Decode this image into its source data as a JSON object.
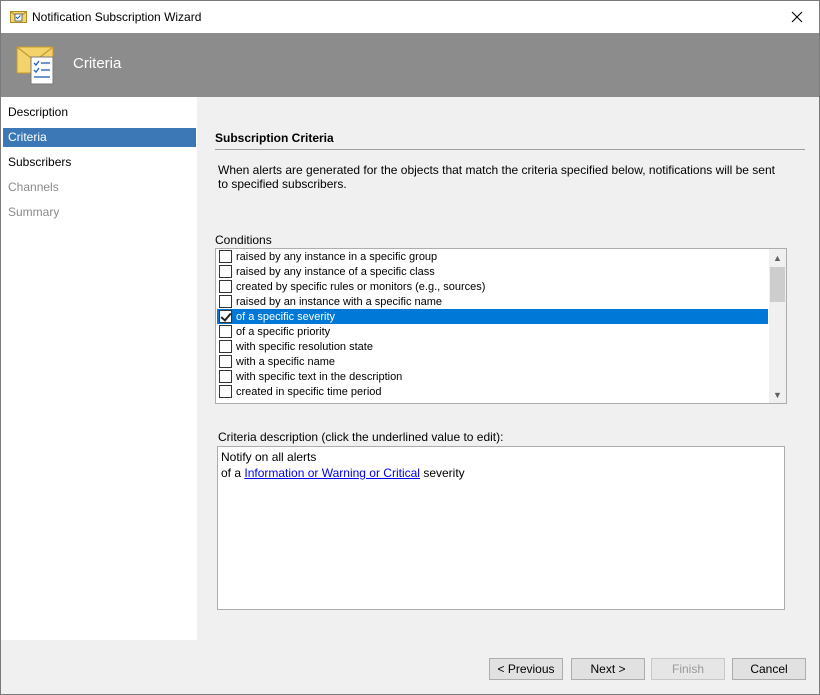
{
  "window": {
    "title": "Notification Subscription Wizard"
  },
  "banner": {
    "title": "Criteria"
  },
  "nav": {
    "items": [
      {
        "label": "Description",
        "state": "normal"
      },
      {
        "label": "Criteria",
        "state": "active"
      },
      {
        "label": "Subscribers",
        "state": "normal"
      },
      {
        "label": "Channels",
        "state": "disabled"
      },
      {
        "label": "Summary",
        "state": "disabled"
      }
    ]
  },
  "main": {
    "section_title": "Subscription Criteria",
    "intro": "When alerts are generated for the objects that match the criteria specified below, notifications will be sent to specified subscribers.",
    "conditions_label": "Conditions",
    "conditions": [
      {
        "label": "raised by any instance in a specific group",
        "checked": false,
        "selected": false
      },
      {
        "label": "raised by any instance of a specific class",
        "checked": false,
        "selected": false
      },
      {
        "label": "created by specific rules or monitors (e.g., sources)",
        "checked": false,
        "selected": false
      },
      {
        "label": "raised by an instance with a specific name",
        "checked": false,
        "selected": false
      },
      {
        "label": "of a specific severity",
        "checked": true,
        "selected": true
      },
      {
        "label": "of a specific priority",
        "checked": false,
        "selected": false
      },
      {
        "label": "with specific resolution state",
        "checked": false,
        "selected": false
      },
      {
        "label": "with a specific name",
        "checked": false,
        "selected": false
      },
      {
        "label": "with specific text in the description",
        "checked": false,
        "selected": false
      },
      {
        "label": "created in specific time period",
        "checked": false,
        "selected": false
      }
    ],
    "criteria_label": "Criteria description (click the underlined value to edit):",
    "criteria": {
      "line1": "Notify on all alerts",
      "line2_prefix": "of a ",
      "line2_link": "Information or Warning or Critical",
      "line2_suffix": " severity"
    }
  },
  "footer": {
    "previous_label": "< Previous",
    "next_label": "Next >",
    "finish_label": "Finish",
    "cancel_label": "Cancel"
  },
  "colors": {
    "banner": "#8c8c8c",
    "nav_active": "#3c78b5",
    "list_selected": "#0078d7",
    "link": "#0000ee"
  },
  "icons": {
    "app": "wizard-envelope-icon",
    "banner": "envelope-checklist-icon",
    "close": "close-icon"
  }
}
